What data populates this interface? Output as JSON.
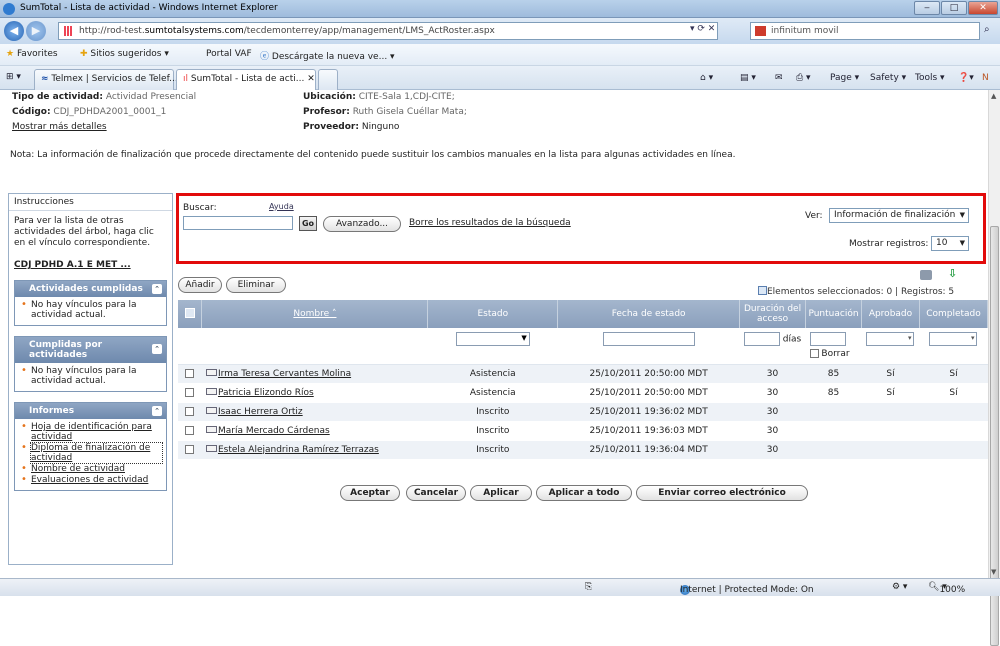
{
  "window": {
    "title": "SumTotal - Lista de actividad - Windows Internet Explorer"
  },
  "address": {
    "url_prefix": "http://rod-test.",
    "url_domain": "sumtotalsystems.com",
    "url_path": "/tecdemonterrey/app/management/LMS_ActRoster.aspx",
    "search_placeholder": "infinitum movil"
  },
  "favorites": {
    "label": "Favorites",
    "suggested": "Sitios sugeridos ▾",
    "portal": "Portal VAF",
    "download": "Descárgate la nueva ve... ▾"
  },
  "tabs": [
    {
      "label": "Telmex | Servicios de Telef..."
    },
    {
      "label": "SumTotal - Lista de acti..."
    }
  ],
  "commands": {
    "page": "Page ▾",
    "safety": "Safety ▾",
    "tools": "Tools ▾"
  },
  "activity": {
    "type_label": "Tipo de actividad:",
    "type_value": "Actividad Presencial",
    "code_label": "Código:",
    "code_value": "CDJ_PDHDA2001_0001_1",
    "more_details": "Mostrar más detalles",
    "location_label": "Ubicación:",
    "location_value": "CITE-Sala 1,CDJ-CITE;",
    "teacher_label": "Profesor:",
    "teacher_value": "Ruth Gisela Cuéllar Mata;",
    "provider_label": "Proveedor:",
    "provider_value": "Ninguno"
  },
  "note": "Nota: La información de finalización que procede directamente del contenido puede sustituir los cambios manuales en la lista para algunas actividades en línea.",
  "sidebar": {
    "header": "Instrucciones",
    "instructions": "Para ver la lista de otras actividades del árbol, haga clic en el vínculo correspondiente.",
    "tree_link": "CDJ PDHD A.1 E MET ...",
    "boxes": [
      {
        "title": "Actividades cumplidas",
        "items": [
          "No hay vínculos para la actividad actual."
        ],
        "links": false
      },
      {
        "title": "Cumplidas por actividades",
        "items": [
          "No hay vínculos para la actividad actual."
        ],
        "links": false
      },
      {
        "title": "Informes",
        "items": [
          "Hoja de identificación para actividad",
          "Diploma de finalización de actividad",
          "Nombre de actividad",
          "Evaluaciones de actividad"
        ],
        "links": true
      }
    ]
  },
  "search": {
    "label": "Buscar:",
    "help": "Ayuda",
    "go": "Go",
    "advanced": "Avanzado...",
    "clear": "Borre los resultados de la búsqueda",
    "view_label": "Ver:",
    "view_value": "Información de finalización",
    "show_label": "Mostrar registros:",
    "show_value": "10"
  },
  "toolbar": {
    "add": "Añadir",
    "delete": "Eliminar",
    "selected": "Elementos seleccionados: 0",
    "records": "Registros: 5"
  },
  "table": {
    "headers": {
      "name": "Nombre ˄",
      "status": "Estado",
      "date": "Fecha de estado",
      "duration": "Duración del acceso",
      "score": "Puntuación",
      "approved": "Aprobado",
      "completed": "Completado"
    },
    "days_label": "días",
    "clear_label": "Borrar",
    "rows": [
      {
        "name": "Irma Teresa Cervantes Molina",
        "status": "Asistencia",
        "date": "25/10/2011 20:50:00 MDT",
        "duration": "30",
        "score": "85",
        "approved": "Sí",
        "completed": "Sí"
      },
      {
        "name": "Patricia Elizondo Ríos",
        "status": "Asistencia",
        "date": "25/10/2011 20:50:00 MDT",
        "duration": "30",
        "score": "85",
        "approved": "Sí",
        "completed": "Sí"
      },
      {
        "name": "Isaac Herrera Ortiz",
        "status": "Inscrito",
        "date": "25/10/2011 19:36:02 MDT",
        "duration": "30",
        "score": "",
        "approved": "",
        "completed": ""
      },
      {
        "name": "María Mercado Cárdenas",
        "status": "Inscrito",
        "date": "25/10/2011 19:36:03 MDT",
        "duration": "30",
        "score": "",
        "approved": "",
        "completed": ""
      },
      {
        "name": "Estela Alejandrina Ramírez Terrazas",
        "status": "Inscrito",
        "date": "25/10/2011 19:36:04 MDT",
        "duration": "30",
        "score": "",
        "approved": "",
        "completed": ""
      }
    ]
  },
  "actions": {
    "accept": "Aceptar",
    "cancel": "Cancelar",
    "apply": "Aplicar",
    "apply_all": "Aplicar a todo",
    "email": "Enviar correo electrónico"
  },
  "statusbar": {
    "zone": "Internet | Protected Mode: On",
    "zoom": "100%"
  },
  "colors": {
    "highlight": "#e20b0b",
    "grid_header": "#8a9fbc",
    "sidebar_header": "#6e89ad"
  }
}
